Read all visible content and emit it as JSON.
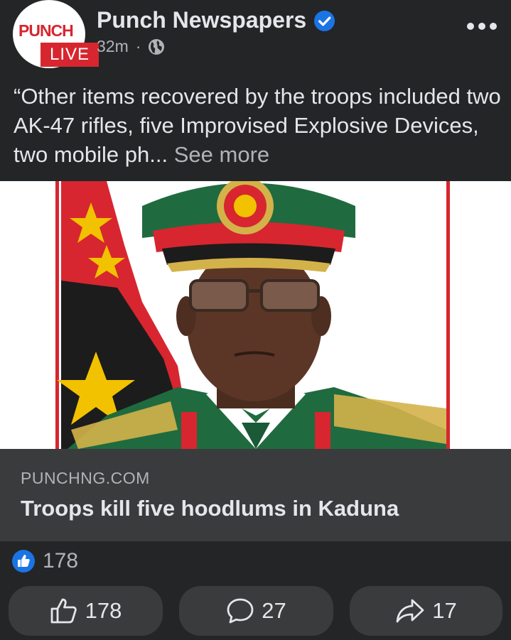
{
  "post": {
    "page_name": "Punch Newspapers",
    "time": "32m",
    "separator": "·",
    "avatar": {
      "logo_text": "PUNCH",
      "badge_text": "LIVE"
    },
    "text": "“Other items recovered by the troops included two AK-47 rifles, five Improvised Explosive Devices, two mobile ph...",
    "see_more": "See more"
  },
  "link_preview": {
    "domain": "PUNCHNG.COM",
    "title": "Troops kill five hoodlums in Kaduna"
  },
  "reactions": {
    "count": "178"
  },
  "actions": {
    "like_count": "178",
    "comment_count": "27",
    "share_count": "17"
  },
  "icons": {
    "verified": "verified-badge-icon",
    "audience": "globe-icon",
    "menu": "more-options-icon",
    "like": "thumbs-up-icon",
    "comment": "comment-icon",
    "share": "share-icon"
  },
  "colors": {
    "background": "#242526",
    "surface": "#3a3b3c",
    "accent_blue": "#1b74e4",
    "brand_red": "#d7262f",
    "text_primary": "#e4e6eb",
    "text_secondary": "#b0b3b8"
  }
}
